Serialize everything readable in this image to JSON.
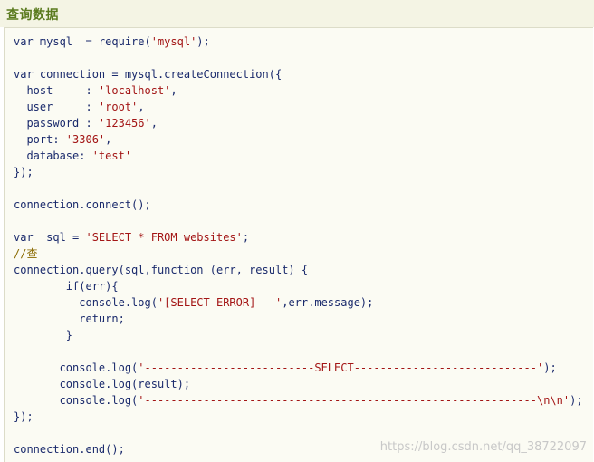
{
  "header": {
    "title": "查询数据"
  },
  "code": {
    "lines": [
      {
        "parts": [
          [
            "var mysql  = require(",
            "kw"
          ],
          [
            "'mysql'",
            "str"
          ],
          [
            ");",
            "kw"
          ]
        ]
      },
      {
        "parts": []
      },
      {
        "parts": [
          [
            "var connection = mysql.createConnection({",
            "kw"
          ]
        ]
      },
      {
        "parts": [
          [
            "  host     : ",
            "kw"
          ],
          [
            "'localhost'",
            "str"
          ],
          [
            ",",
            "kw"
          ]
        ]
      },
      {
        "parts": [
          [
            "  user     : ",
            "kw"
          ],
          [
            "'root'",
            "str"
          ],
          [
            ",",
            "kw"
          ]
        ]
      },
      {
        "parts": [
          [
            "  password : ",
            "kw"
          ],
          [
            "'123456'",
            "str"
          ],
          [
            ",",
            "kw"
          ]
        ]
      },
      {
        "parts": [
          [
            "  port: ",
            "kw"
          ],
          [
            "'3306'",
            "str"
          ],
          [
            ",",
            "kw"
          ]
        ]
      },
      {
        "parts": [
          [
            "  database: ",
            "kw"
          ],
          [
            "'test'",
            "str"
          ]
        ]
      },
      {
        "parts": [
          [
            "});",
            "kw"
          ]
        ]
      },
      {
        "parts": []
      },
      {
        "parts": [
          [
            "connection.connect();",
            "kw"
          ]
        ]
      },
      {
        "parts": []
      },
      {
        "parts": [
          [
            "var  sql = ",
            "kw"
          ],
          [
            "'SELECT * FROM websites'",
            "str"
          ],
          [
            ";",
            "kw"
          ]
        ]
      },
      {
        "parts": [
          [
            "//查",
            "cm"
          ]
        ]
      },
      {
        "parts": [
          [
            "connection.query(sql,function (err, result) {",
            "kw"
          ]
        ]
      },
      {
        "parts": [
          [
            "        if(err){",
            "kw"
          ]
        ]
      },
      {
        "parts": [
          [
            "          console.log(",
            "kw"
          ],
          [
            "'[SELECT ERROR] - '",
            "str"
          ],
          [
            ",err.message);",
            "kw"
          ]
        ]
      },
      {
        "parts": [
          [
            "          return;",
            "kw"
          ]
        ]
      },
      {
        "parts": [
          [
            "        }",
            "kw"
          ]
        ]
      },
      {
        "parts": []
      },
      {
        "parts": [
          [
            "       console.log(",
            "kw"
          ],
          [
            "'--------------------------SELECT----------------------------'",
            "str"
          ],
          [
            ");",
            "kw"
          ]
        ]
      },
      {
        "parts": [
          [
            "       console.log(result);",
            "kw"
          ]
        ]
      },
      {
        "parts": [
          [
            "       console.log(",
            "kw"
          ],
          [
            "'------------------------------------------------------------\\n\\n'",
            "str"
          ],
          [
            ");",
            "kw"
          ]
        ]
      },
      {
        "parts": [
          [
            "});",
            "kw"
          ]
        ]
      },
      {
        "parts": []
      },
      {
        "parts": [
          [
            "connection.end();",
            "kw"
          ]
        ]
      }
    ]
  },
  "watermark": "https://blog.csdn.net/qq_38722097"
}
